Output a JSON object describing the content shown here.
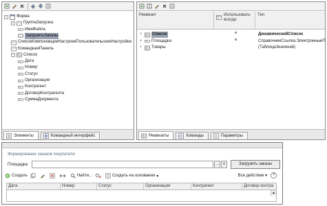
{
  "left_tree": {
    "items": [
      {
        "label": "Форма",
        "icon": "form-icon",
        "expander": "−",
        "level": 0
      },
      {
        "label": "ГруппаЗагрузка",
        "icon": "group-icon",
        "expander": "−",
        "level": 1
      },
      {
        "label": "ИмяФайла",
        "icon": "field-icon",
        "expander": "",
        "level": 2
      },
      {
        "label": "ЗагрузитьЗаказы",
        "icon": "button-icon",
        "expander": "",
        "level": 2
      },
      {
        "label": "СписокКомпоновщикНастроекПользовательскиеНастройки",
        "icon": "group-icon",
        "expander": "",
        "level": 1
      },
      {
        "label": "КоманднаяПанель",
        "icon": "group-icon",
        "expander": "",
        "level": 1
      },
      {
        "label": "Список",
        "icon": "table-icon",
        "expander": "−",
        "level": 1
      },
      {
        "label": "Дата",
        "icon": "field-icon",
        "expander": "",
        "level": 2
      },
      {
        "label": "Номер",
        "icon": "field-icon",
        "expander": "",
        "level": 2
      },
      {
        "label": "Статус",
        "icon": "field-icon",
        "expander": "",
        "level": 2
      },
      {
        "label": "Организация",
        "icon": "field-icon",
        "expander": "",
        "level": 2
      },
      {
        "label": "Контрагент",
        "icon": "field-icon",
        "expander": "",
        "level": 2
      },
      {
        "label": "ДоговорКонтрагента",
        "icon": "field-icon",
        "expander": "",
        "level": 2
      },
      {
        "label": "СуммаДокумента",
        "icon": "field-icon",
        "expander": "",
        "level": 2
      }
    ],
    "selected_index": 3
  },
  "left_tabs": [
    {
      "label": "Элементы",
      "icon": "elements-icon",
      "active": true
    },
    {
      "label": "Командный интерфейс",
      "icon": "command-interface-icon",
      "active": false
    }
  ],
  "right_grid": {
    "headers": [
      "Реквизит",
      "Использовать всегда",
      "Тип"
    ],
    "rows": [
      {
        "name": "Список",
        "always": true,
        "type": "ДинамическийСписок",
        "selected": true,
        "bold": true
      },
      {
        "name": "Площадка",
        "always": true,
        "type": "СправочникСсылка.ЭлектронныеП",
        "selected": false,
        "bold": false
      },
      {
        "name": "Товары",
        "always": false,
        "type": "(ТаблицаЗначений)",
        "selected": false,
        "bold": false
      }
    ]
  },
  "right_tabs": [
    {
      "label": "Реквизиты",
      "icon": "attributes-icon",
      "active": true
    },
    {
      "label": "Команды",
      "icon": "commands-icon",
      "active": false
    },
    {
      "label": "Параметры",
      "icon": "parameters-icon",
      "active": false
    }
  ],
  "form": {
    "title": "Формирование заказов покупателя",
    "field_label": "Площадка",
    "field_value": "",
    "select_button": "...",
    "clear_button": "x",
    "load_button": "Загрузить заказы",
    "toolbar": {
      "create": "Создать",
      "find": "Найти...",
      "create_based_on": "Создать на основании",
      "all_actions": "Все действия",
      "help": "?"
    },
    "columns": [
      "Дата",
      "Номер",
      "Статус",
      "Организация",
      "Контрагент",
      "Договор контра"
    ],
    "scroll_up": "▲"
  },
  "colors": {
    "selection": "#9aa3b3",
    "form_title": "#5c6e80",
    "pane_border": "#8c8c8c"
  }
}
